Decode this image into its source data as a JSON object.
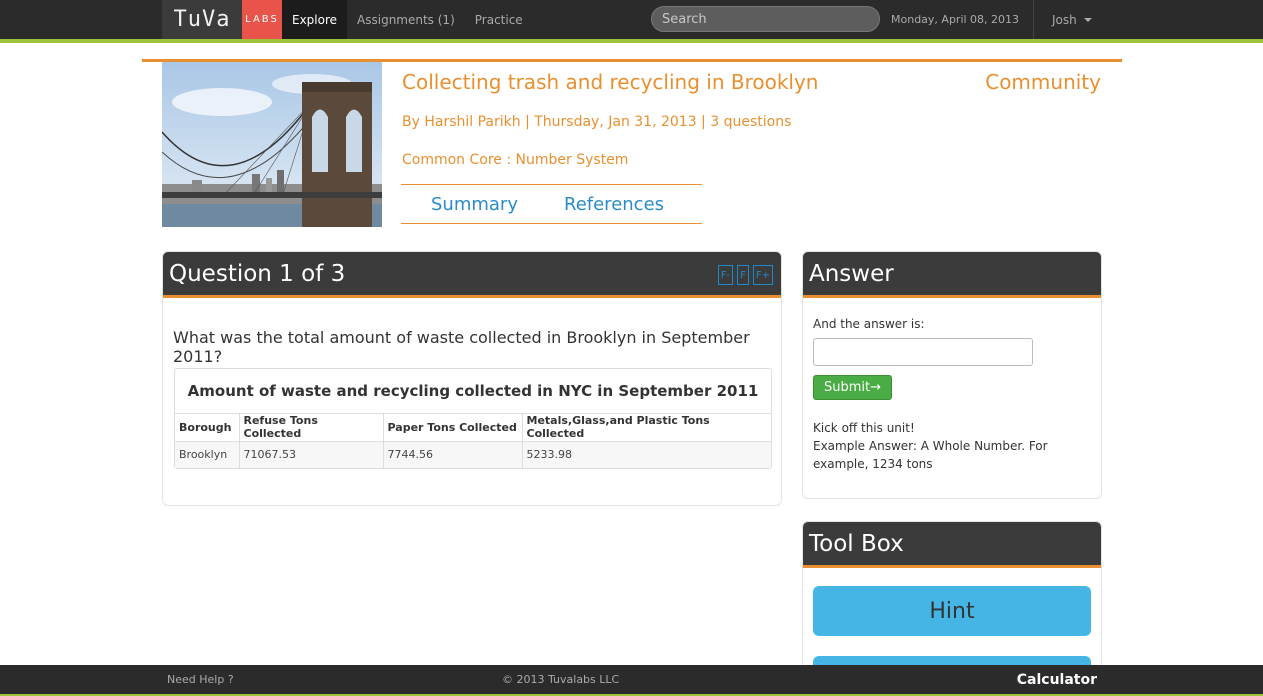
{
  "nav": {
    "brand": "TuVa",
    "labs": "LABS",
    "links": [
      "Explore",
      "Assignments (1)",
      "Practice"
    ],
    "search_placeholder": "Search",
    "date": "Monday, April 08, 2013",
    "user": "Josh"
  },
  "unit": {
    "title": "Collecting trash and recycling in Brooklyn",
    "community": "Community",
    "meta": "By Harshil Parikh | Thursday, Jan 31, 2013 | 3 questions",
    "core": "Common Core : Number System",
    "tabs": [
      "Summary",
      "References"
    ]
  },
  "question": {
    "header": "Question 1 of 3",
    "font_buttons": [
      "F-",
      "F",
      "F+"
    ],
    "text": "What was the total amount of waste collected in Brooklyn in September 2011?",
    "table": {
      "title": "Amount of waste and recycling collected in NYC in September 2011",
      "columns": [
        "Borough",
        "Refuse Tons Collected",
        "Paper Tons Collected",
        "Metals,Glass,and Plastic Tons Collected"
      ],
      "rows": [
        [
          "Brooklyn",
          "71067.53",
          "7744.56",
          "5233.98"
        ]
      ]
    }
  },
  "answer": {
    "header": "Answer",
    "label": "And the answer is:",
    "input_value": "",
    "submit_label": "Submit→",
    "note_line1": "Kick off this unit!",
    "note_line2": "Example Answer: A Whole Number. For example, 1234 tons"
  },
  "toolbox": {
    "header": "Tool Box",
    "hint_label": "Hint"
  },
  "footer": {
    "help": "Need Help ?",
    "copyright": "© 2013 Tuvalabs LLC",
    "calculator": "Calculator"
  },
  "colors": {
    "accent_orange": "#e8902f",
    "nav_green": "#9cc33b",
    "link_blue": "#2a8bc9",
    "hint_blue": "#45b5e6",
    "submit_green": "#4aac45"
  }
}
